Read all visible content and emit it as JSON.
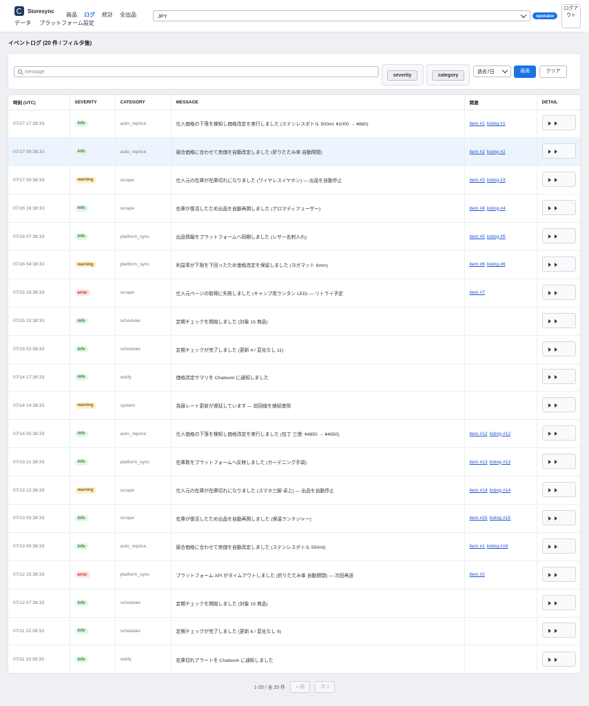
{
  "header": {
    "brand": "Storesync",
    "nav_top": [
      "商品",
      "ログ",
      "統計",
      "全出品"
    ],
    "nav_active": "ログ",
    "nav_bottom": [
      "データ",
      "プラットフォーム設定"
    ],
    "currency": "JPY",
    "role": "operator",
    "logout": "ログアウト"
  },
  "page": {
    "title": "イベントログ (20 件 / フィルタ後)"
  },
  "filters": {
    "search_placeholder": "message",
    "severity_label": "severity",
    "category_label": "category",
    "period": "過去7日",
    "apply": "適用",
    "clear": "クリア"
  },
  "table": {
    "columns": [
      "時刻 (UTC)",
      "SEVERITY",
      "CATEGORY",
      "MESSAGE",
      "関連",
      "DETAIL"
    ],
    "rows": [
      {
        "time": "07/17 17:38:33",
        "severity": "info",
        "category": "auto_reprice",
        "message": "仕入価格の下落を検知し価格改定を実行しました (ステンレスボトル 500ml: ¥1000 → ¥880)",
        "item": "item #1",
        "listing": "listing #1"
      },
      {
        "time": "07/17 09:38:33",
        "severity": "info",
        "category": "auto_reprice",
        "message": "競合価格に合わせて売価を自動改定しました (折りたたみ傘 自動開閉)",
        "item": "item #2",
        "listing": "listing #2",
        "highlight": true
      },
      {
        "time": "07/17 00:38:33",
        "severity": "warning",
        "category": "scrape",
        "message": "仕入元の在庫が在庫切れになりました (ワイヤレスイヤホン) — 出品を自動停止",
        "item": "item #3",
        "listing": "listing #3"
      },
      {
        "time": "07/16 16:38:33",
        "severity": "info",
        "category": "scrape",
        "message": "在庫が復活したため出品を自動再開しました (アロマディフューザー)",
        "item": "item #4",
        "listing": "listing #4"
      },
      {
        "time": "07/16 07:38:33",
        "severity": "info",
        "category": "platform_sync",
        "message": "出品情報をプラットフォームへ同期しました (レザー名刺入れ)",
        "item": "item #5",
        "listing": "listing #5"
      },
      {
        "time": "07/16 04:38:33",
        "severity": "warning",
        "category": "platform_sync",
        "message": "利益率が下限を下回ったため価格改定を保留しました (ヨガマット 6mm)",
        "item": "item #6",
        "listing": "listing #6"
      },
      {
        "time": "07/15 19:38:33",
        "severity": "error",
        "category": "scrape",
        "message": "仕入元ページの取得に失敗しました (キャンプ用ランタン LED) — リトライ予定",
        "item": "item #7",
        "listing": ""
      },
      {
        "time": "07/15 10:38:33",
        "severity": "info",
        "category": "scheduler",
        "message": "定期チェックを開始しました (対象 15 商品)",
        "item": "",
        "listing": ""
      },
      {
        "time": "07/15 02:38:33",
        "severity": "info",
        "category": "scheduler",
        "message": "定期チェックが完了しました (更新 4 / 変化なし 11)",
        "item": "",
        "listing": ""
      },
      {
        "time": "07/14 17:38:33",
        "severity": "info",
        "category": "notify",
        "message": "価格改定サマリを Chatwork に通知しました",
        "item": "",
        "listing": ""
      },
      {
        "time": "07/14 14:38:33",
        "severity": "warning",
        "category": "system",
        "message": "為替レート更新が遅延しています — 前回値を継続使用",
        "item": "",
        "listing": ""
      },
      {
        "time": "07/14 05:38:33",
        "severity": "info",
        "category": "auto_reprice",
        "message": "仕入価格の下落を検知し価格改定を実行しました (包丁 三徳: ¥4850 → ¥4650)",
        "item": "item #12",
        "listing": "listing #12"
      },
      {
        "time": "07/13 21:38:33",
        "severity": "info",
        "category": "platform_sync",
        "message": "在庫数をプラットフォームへ反映しました (ガーデニング手袋)",
        "item": "item #13",
        "listing": "listing #13"
      },
      {
        "time": "07/13 12:38:33",
        "severity": "warning",
        "category": "scrape",
        "message": "仕入元の在庫が在庫切れになりました (スマホ三脚 卓上) — 出品を自動停止",
        "item": "item #14",
        "listing": "listing #14"
      },
      {
        "time": "07/13 03:38:33",
        "severity": "info",
        "category": "scrape",
        "message": "在庫が復活したため出品を自動再開しました (保温ランチジャー)",
        "item": "item #15",
        "listing": "listing #15"
      },
      {
        "time": "07/13 00:38:33",
        "severity": "info",
        "category": "auto_reprice",
        "message": "競合価格に合わせて売価を自動改定しました (ステンレスボトル 500ml)",
        "item": "item #1",
        "listing": "listing #16"
      },
      {
        "time": "07/12 15:38:33",
        "severity": "error",
        "category": "platform_sync",
        "message": "プラットフォーム API がタイムアウトしました (折りたたみ傘 自動開閉) — 次回再送",
        "item": "item #2",
        "listing": ""
      },
      {
        "time": "07/12 07:38:33",
        "severity": "info",
        "category": "scheduler",
        "message": "定期チェックを開始しました (対象 15 商品)",
        "item": "",
        "listing": ""
      },
      {
        "time": "07/11 22:38:33",
        "severity": "info",
        "category": "scheduler",
        "message": "定期チェックが完了しました (更新 6 / 変化なし 9)",
        "item": "",
        "listing": ""
      },
      {
        "time": "07/11 13:38:33",
        "severity": "info",
        "category": "notify",
        "message": "在庫切れアラートを Chatwork に通知しました",
        "item": "",
        "listing": ""
      }
    ]
  },
  "pagination": {
    "summary": "1-20 / 全 20 件",
    "prev": "« 前",
    "next": "次 »"
  }
}
